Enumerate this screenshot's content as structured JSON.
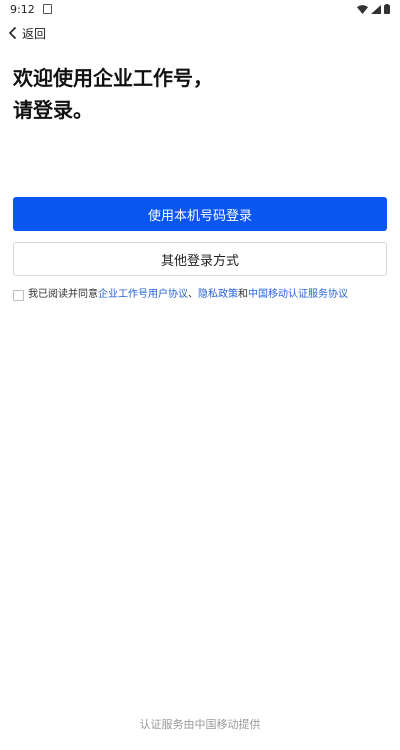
{
  "status_bar": {
    "time": "9:12",
    "icons": [
      "notification-icon",
      "wifi-icon",
      "signal-icon",
      "battery-icon"
    ]
  },
  "nav": {
    "back_label": "返回"
  },
  "title": {
    "line1": "欢迎使用企业工作号，",
    "line2": "请登录。"
  },
  "buttons": {
    "primary_label": "使用本机号码登录",
    "secondary_label": "其他登录方式"
  },
  "agreement": {
    "prefix": "我已阅读并同意",
    "link1": "企业工作号用户协议",
    "sep1": "、",
    "link2": "隐私政策",
    "sep2": "和",
    "link3": "中国移动认证服务协议"
  },
  "footer": {
    "text": "认证服务由中国移动提供"
  },
  "colors": {
    "primary": "#0a56f0",
    "link": "#2563d6",
    "footer_text": "#999999"
  }
}
